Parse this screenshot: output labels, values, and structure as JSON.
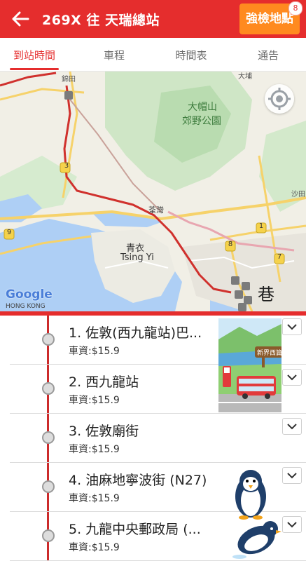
{
  "header": {
    "back_icon": "arrow-left-icon",
    "route_title": "269X 往 天瑞總站",
    "quick_check_label": "強檢地點",
    "quick_check_badge": "8"
  },
  "tabs": [
    {
      "label": "到站時間",
      "active": true
    },
    {
      "label": "車程",
      "active": false
    },
    {
      "label": "時間表",
      "active": false
    },
    {
      "label": "通告",
      "active": false
    }
  ],
  "map": {
    "labels": {
      "park_1": "大帽山",
      "park_2": "郊野公園",
      "tsuen_wan": "荃灣",
      "tsing_yi_zh": "青衣",
      "tsing_yi_en": "Tsing Yi",
      "kam_tin": "錦田",
      "tai_wai": "大埔",
      "sha_tin": "沙田",
      "kowloon": "巷",
      "google": "Google",
      "hk_text": "HONG KONG",
      "route_3": "3",
      "route_9": "9",
      "route_8": "8",
      "route_1": "1",
      "route_7": "7"
    },
    "locate_icon": "my-location-icon"
  },
  "stops": [
    {
      "name": "1. 佐敦(西九龍站)巴...",
      "fare": "車資:$15.9"
    },
    {
      "name": "2. 西九龍站",
      "fare": "車資:$15.9"
    },
    {
      "name": "3. 佐敦廟街",
      "fare": "車資:$15.9"
    },
    {
      "name": "4. 油麻地寧波街 (N27)",
      "fare": "車資:$15.9"
    },
    {
      "name": "5. 九龍中央郵政局 (...",
      "fare": "車資:$15.9"
    }
  ],
  "ad": {
    "sign_text": "新界西篇"
  },
  "colors": {
    "brand_red": "#e52d2d",
    "accent_orange": "#ff8a1f"
  }
}
